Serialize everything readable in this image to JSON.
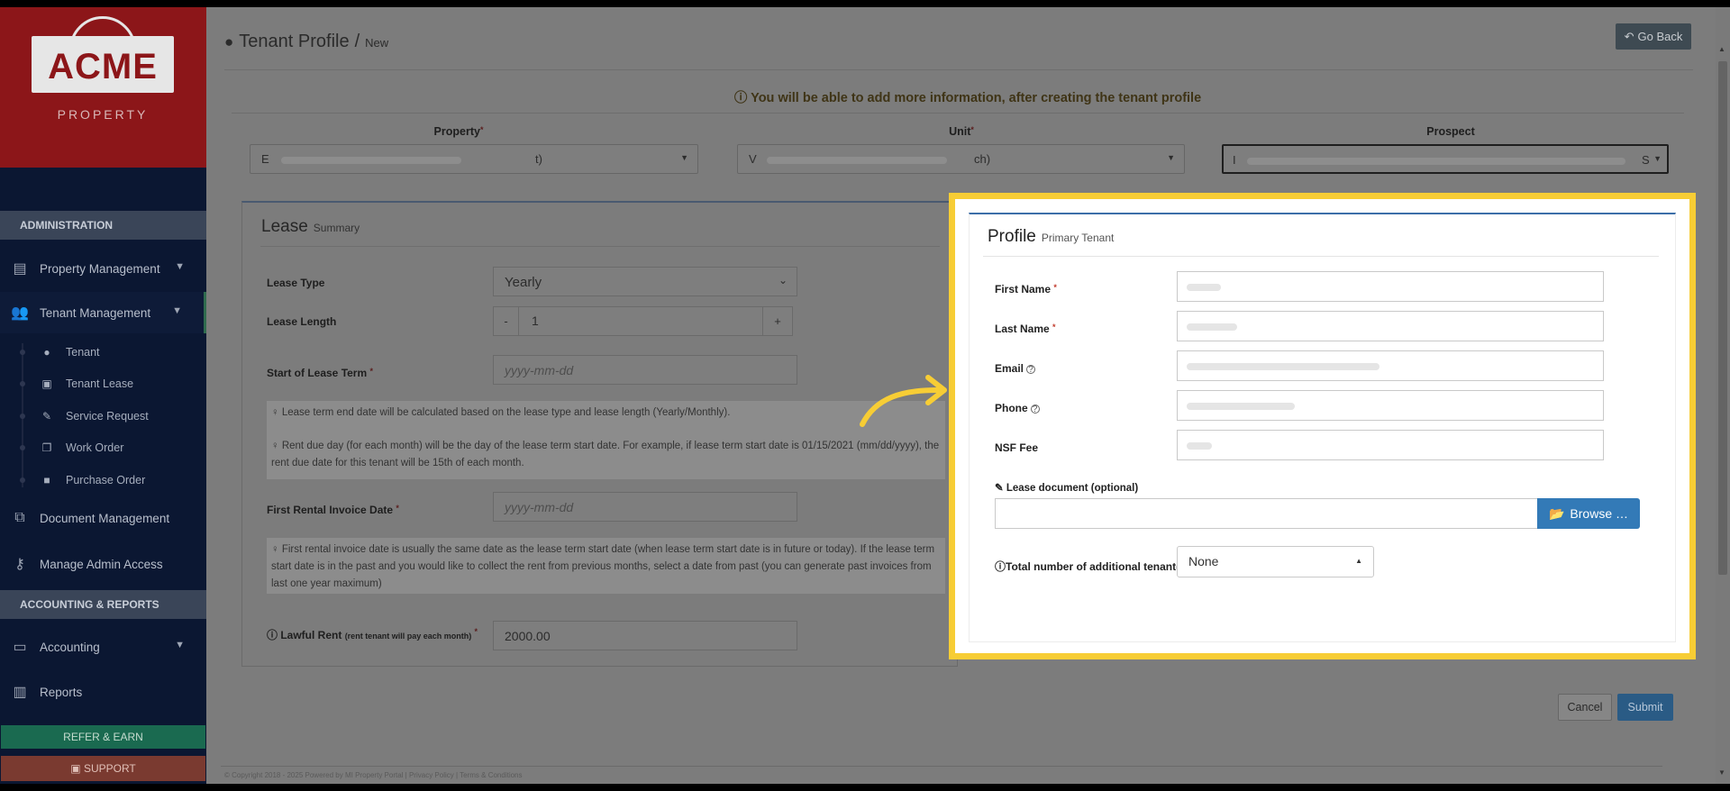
{
  "sidebar": {
    "logo_text": "ACME",
    "logo_sub": "PROPERTY",
    "heading_admin": "ADMINISTRATION",
    "heading_accounting": "ACCOUNTING & REPORTS",
    "items": {
      "property_management": "Property Management",
      "tenant_management": "Tenant Management",
      "document_management": "Document Management",
      "manage_admin_access": "Manage Admin Access",
      "accounting": "Accounting",
      "reports": "Reports"
    },
    "sub_items": {
      "tenant": "Tenant",
      "tenant_lease": "Tenant Lease",
      "service_request": "Service Request",
      "work_order": "Work Order",
      "purchase_order": "Purchase Order"
    },
    "refer_label": "REFER & EARN",
    "support_label": "SUPPORT"
  },
  "header": {
    "title": "Tenant Profile",
    "separator": "/",
    "subtitle": "New",
    "go_back_label": "Go Back"
  },
  "notice": "You will be able to add more information, after creating the tenant profile",
  "selectors": {
    "property": {
      "label": "Property",
      "value_start": "E",
      "value_end": "t)"
    },
    "unit": {
      "label": "Unit",
      "value_start": "V",
      "value_end": "ch)"
    },
    "prospect": {
      "label": "Prospect",
      "value_start": "I",
      "value_end": "S"
    }
  },
  "lease": {
    "title": "Lease",
    "subtitle": "Summary",
    "lease_type_label": "Lease Type",
    "lease_type_value": "Yearly",
    "lease_length_label": "Lease Length",
    "lease_length_value": "1",
    "minus": "-",
    "plus": "+",
    "start_label": "Start of Lease Term",
    "start_placeholder": "yyyy-mm-dd",
    "note1": "Lease term end date will be calculated based on the lease type and lease length (Yearly/Monthly).",
    "note2": "Rent due day (for each month) will be the day of the lease term start date. For example, if lease term start date is 01/15/2021 (mm/dd/yyyy), the rent due date for this tenant will be 15th of each month.",
    "first_invoice_label": "First Rental Invoice Date",
    "first_invoice_placeholder": "yyyy-mm-dd",
    "note3": "First rental invoice date is usually the same date as the lease term start date (when lease term start date is in future or today). If the lease term start date is in the past and you would like to collect the rent from previous months, select a date from past (you can generate past invoices from last one year maximum)",
    "lawful_rent_label": "Lawful Rent",
    "lawful_rent_hint": "(rent tenant will pay each month)",
    "lawful_rent_value": "2000.00"
  },
  "profile": {
    "title": "Profile",
    "subtitle": "Primary Tenant",
    "first_name_label": "First Name",
    "last_name_label": "Last Name",
    "email_label": "Email",
    "phone_label": "Phone",
    "nsf_fee_label": "NSF Fee",
    "lease_doc_label": "Lease document (optional)",
    "browse_label": "Browse …",
    "additional_label": "Total number of additional tenant(s)",
    "additional_value": "None"
  },
  "actions": {
    "cancel_label": "Cancel",
    "submit_label": "Submit"
  },
  "footer": "© Copyright 2018 - 2025 Powered by MI Property Portal | Privacy Policy | Terms & Conditions",
  "colors": {
    "highlight": "#f7cd35",
    "primary_button": "#337ab7",
    "sidebar_bg": "#0b1732",
    "logo_bg": "#8c1619"
  }
}
